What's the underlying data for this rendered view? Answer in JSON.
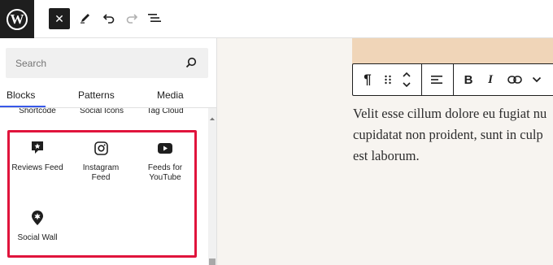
{
  "toolbar": {
    "logo_letter": "W",
    "close_symbol": "✕"
  },
  "inserter": {
    "search_placeholder": "Search",
    "tabs": [
      {
        "label": "Blocks",
        "active": true
      },
      {
        "label": "Patterns",
        "active": false
      },
      {
        "label": "Media",
        "active": false
      }
    ],
    "cut_off_labels": [
      "Shortcode",
      "Social Icons",
      "Tag Cloud"
    ],
    "blocks": [
      {
        "label": "Reviews Feed",
        "icon": "reviews-feed-icon"
      },
      {
        "label": "Instagram Feed",
        "icon": "instagram-icon"
      },
      {
        "label": "Feeds for YouTube",
        "icon": "youtube-icon"
      },
      {
        "label": "Social Wall",
        "icon": "social-wall-icon"
      }
    ]
  },
  "block_toolbar": {
    "buttons": [
      "paragraph-icon",
      "drag-handle-icon",
      "move-up-down-icon",
      "align-icon",
      "bold-icon",
      "italic-icon",
      "link-icon",
      "more-options-icon"
    ],
    "bold_label": "B",
    "italic_label": "I",
    "paragraph_symbol": "¶"
  },
  "editor": {
    "paragraph_lines": [
      "Velit esse cillum dolore eu fugiat nu",
      "cupidatat non proident, sunt in culp",
      "est laborum."
    ]
  },
  "colors": {
    "highlight": "#e0143c",
    "accent": "#3858e9",
    "dark": "#1e1e1e",
    "canvas_bg": "#f7f4f0",
    "cover_bg": "#f0d5b8"
  }
}
